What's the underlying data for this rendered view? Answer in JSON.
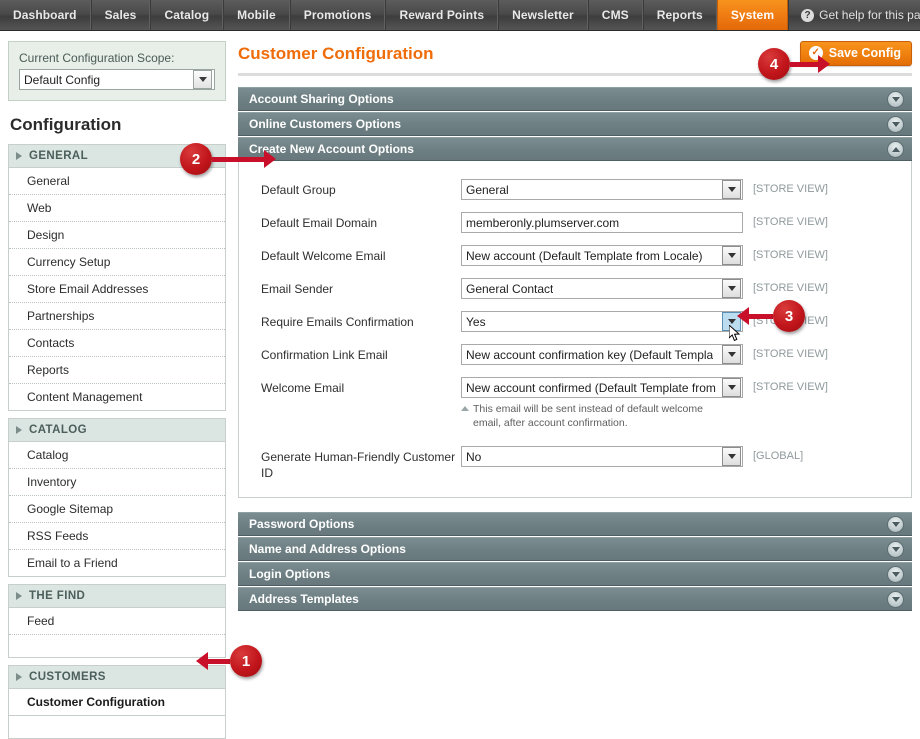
{
  "topnav": {
    "items": [
      {
        "label": "Dashboard",
        "active": false
      },
      {
        "label": "Sales",
        "active": false
      },
      {
        "label": "Catalog",
        "active": false
      },
      {
        "label": "Mobile",
        "active": false
      },
      {
        "label": "Promotions",
        "active": false
      },
      {
        "label": "Reward Points",
        "active": false
      },
      {
        "label": "Newsletter",
        "active": false
      },
      {
        "label": "CMS",
        "active": false
      },
      {
        "label": "Reports",
        "active": false
      },
      {
        "label": "System",
        "active": true
      }
    ],
    "help_label": "Get help for this page",
    "help_icon": "question-mark-circle-icon",
    "active_color": "#f07c13"
  },
  "sidebar": {
    "scope_label": "Current Configuration Scope:",
    "scope_value": "Default Config",
    "config_title": "Configuration",
    "groups": [
      {
        "label": "GENERAL",
        "items": [
          "General",
          "Web",
          "Design",
          "Currency Setup",
          "Store Email Addresses",
          "Partnerships",
          "Contacts",
          "Reports",
          "Content Management"
        ]
      },
      {
        "label": "CATALOG",
        "items": [
          "Catalog",
          "Inventory",
          "Google Sitemap",
          "RSS Feeds",
          "Email to a Friend"
        ]
      },
      {
        "label": "THE FIND",
        "items": [
          "Feed"
        ]
      },
      {
        "label": "CUSTOMERS",
        "items": [
          "Customer Configuration"
        ],
        "selected": "Customer Configuration"
      }
    ]
  },
  "main": {
    "page_title": "Customer Configuration",
    "save_label": "Save Config",
    "save_icon": "check-circle-icon",
    "sections": [
      {
        "label": "Account Sharing Options",
        "open": false
      },
      {
        "label": "Online Customers Options",
        "open": false
      },
      {
        "label": "Create New Account Options",
        "open": true
      },
      {
        "label": "Password Options",
        "open": false
      },
      {
        "label": "Name and Address Options",
        "open": false
      },
      {
        "label": "Login Options",
        "open": false
      },
      {
        "label": "Address Templates",
        "open": false
      }
    ],
    "fields": [
      {
        "label": "Default Group",
        "type": "select",
        "value": "General",
        "scope": "[STORE VIEW]"
      },
      {
        "label": "Default Email Domain",
        "type": "text",
        "value": "memberonly.plumserver.com",
        "scope": "[STORE VIEW]"
      },
      {
        "label": "Default Welcome Email",
        "type": "select",
        "value": "New account (Default Template from Locale)",
        "scope": "[STORE VIEW]"
      },
      {
        "label": "Email Sender",
        "type": "select",
        "value": "General Contact",
        "scope": "[STORE VIEW]"
      },
      {
        "label": "Require Emails Confirmation",
        "type": "select",
        "value": "Yes",
        "scope": "[STORE VIEW]",
        "focused": true
      },
      {
        "label": "Confirmation Link Email",
        "type": "select",
        "value": "New account confirmation key (Default Templa",
        "scope": "[STORE VIEW]"
      },
      {
        "label": "Welcome Email",
        "type": "select",
        "value": "New account confirmed (Default Template from",
        "scope": "[STORE VIEW]",
        "note": "This email will be sent instead of default welcome email, after account confirmation."
      },
      {
        "label": "Generate Human-Friendly Customer ID",
        "type": "select",
        "value": "No",
        "scope": "[GLOBAL]"
      }
    ]
  },
  "callouts": [
    {
      "number": "1",
      "target": "sidebar-item-customer-configuration"
    },
    {
      "number": "2",
      "target": "section-create-new-account-options"
    },
    {
      "number": "3",
      "target": "require-emails-confirmation-select"
    },
    {
      "number": "4",
      "target": "save-config-button"
    }
  ]
}
